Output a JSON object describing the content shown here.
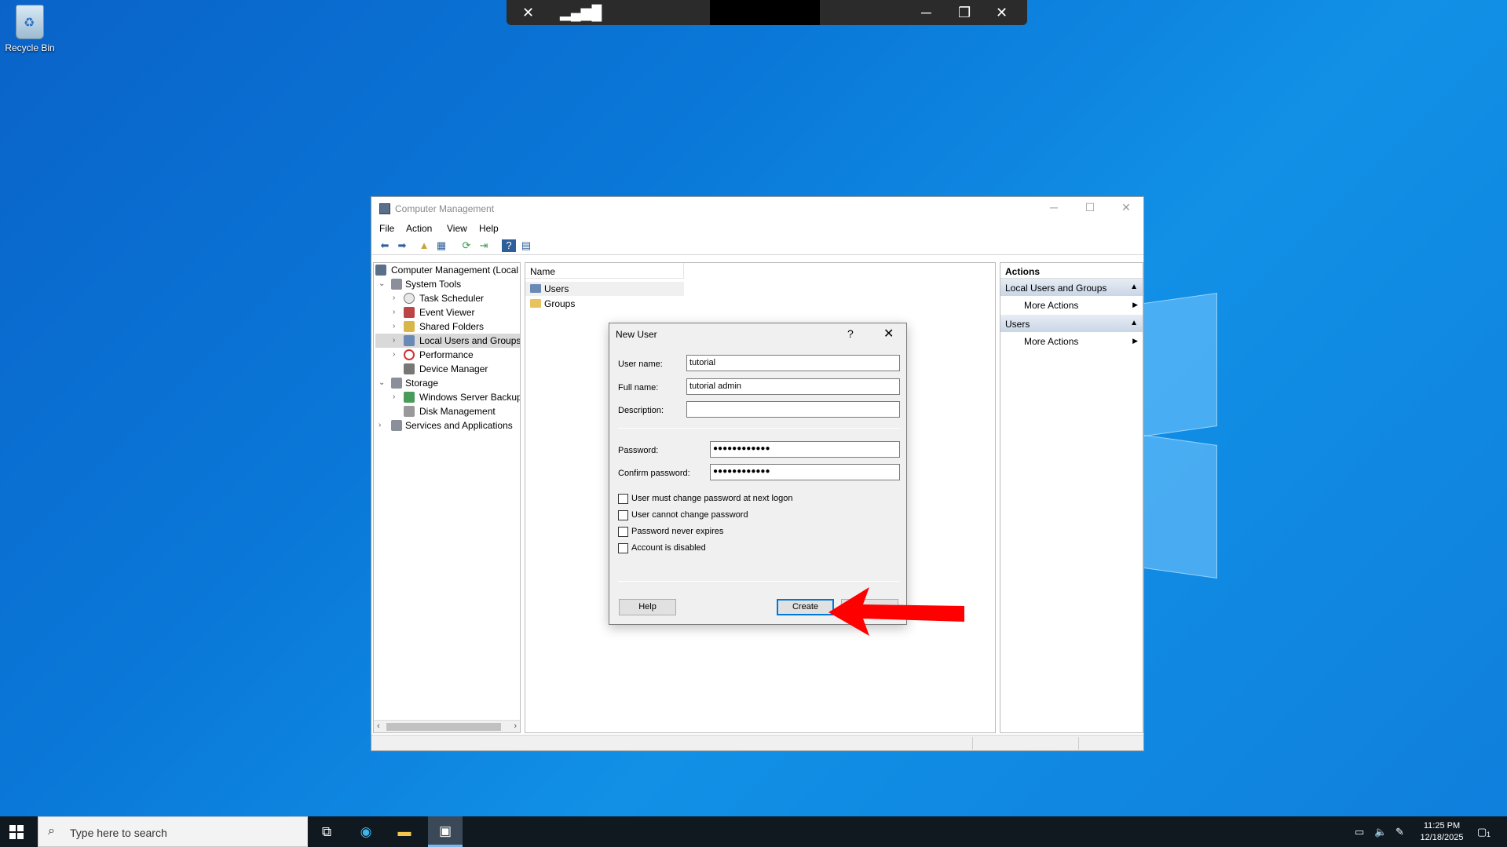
{
  "desktop": {
    "recycle_bin_label": "Recycle Bin"
  },
  "window": {
    "title": "Computer Management",
    "menu": [
      "File",
      "Action",
      "View",
      "Help"
    ],
    "tree": {
      "root": "Computer Management (Local",
      "system_tools": "System Tools",
      "task_scheduler": "Task Scheduler",
      "event_viewer": "Event Viewer",
      "shared_folders": "Shared Folders",
      "local_users_groups": "Local Users and Groups",
      "performance": "Performance",
      "device_manager": "Device Manager",
      "storage": "Storage",
      "windows_server_backup": "Windows Server Backup",
      "disk_management": "Disk Management",
      "services_apps": "Services and Applications"
    },
    "list": {
      "column_name": "Name",
      "items": [
        "Users",
        "Groups"
      ]
    },
    "actions_pane": {
      "header": "Actions",
      "section1": "Local Users and Groups",
      "section1_action": "More Actions",
      "section2": "Users",
      "section2_action": "More Actions"
    }
  },
  "dialog": {
    "title": "New User",
    "help_glyph": "?",
    "username_label": "User name:",
    "username_value": "tutorial",
    "fullname_label": "Full name:",
    "fullname_value": "tutorial admin",
    "description_label": "Description:",
    "description_value": "",
    "password_label": "Password:",
    "password_value": "●●●●●●●●●●●●",
    "confirm_label": "Confirm password:",
    "confirm_value": "●●●●●●●●●●●●",
    "checkboxes": [
      {
        "label": "User must change password at next logon",
        "checked": false
      },
      {
        "label": "User cannot change password",
        "checked": false
      },
      {
        "label": "Password never expires",
        "checked": false
      },
      {
        "label": "Account is disabled",
        "checked": false
      }
    ],
    "help_button": "Help",
    "create_button": "Create"
  },
  "taskbar": {
    "search_placeholder": "Type here to search",
    "time": "11:25 PM",
    "date": "12/18/2025",
    "notification_count": "1"
  },
  "colors": {
    "annotation_arrow": "#ff0000",
    "default_button_border": "#0078d7",
    "actions_section_bg": "#c9d6e6"
  }
}
